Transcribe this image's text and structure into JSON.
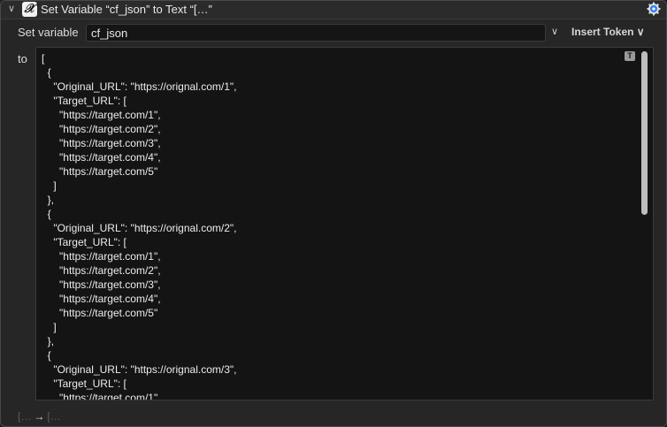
{
  "titlebar": {
    "collapse_glyph": "∨",
    "action_icon": "variable-x-icon",
    "action_glyph": "𝒳",
    "title": "Set Variable “cf_json” to Text “[…”",
    "gear_icon": "gear-icon",
    "gear_color": "#2f7cf6"
  },
  "variable_row": {
    "label": "Set variable",
    "value": "cf_json",
    "chevron": "∨",
    "insert_token_label": "Insert Token ∨"
  },
  "text_row": {
    "label": "to",
    "badge": "T",
    "text": "[\n  {\n    \"Original_URL\": \"https://orignal.com/1\",\n    \"Target_URL\": [\n      \"https://target.com/1\",\n      \"https://target.com/2\",\n      \"https://target.com/3\",\n      \"https://target.com/4\",\n      \"https://target.com/5\"\n    ]\n  },\n  {\n    \"Original_URL\": \"https://orignal.com/2\",\n    \"Target_URL\": [\n      \"https://target.com/1\",\n      \"https://target.com/2\",\n      \"https://target.com/3\",\n      \"https://target.com/4\",\n      \"https://target.com/5\"\n    ]\n  },\n  {\n    \"Original_URL\": \"https://orignal.com/3\",\n    \"Target_URL\": [\n      \"https://target.com/1\","
  },
  "footer": {
    "from": "[…",
    "arrow": "→",
    "to": "[…"
  }
}
